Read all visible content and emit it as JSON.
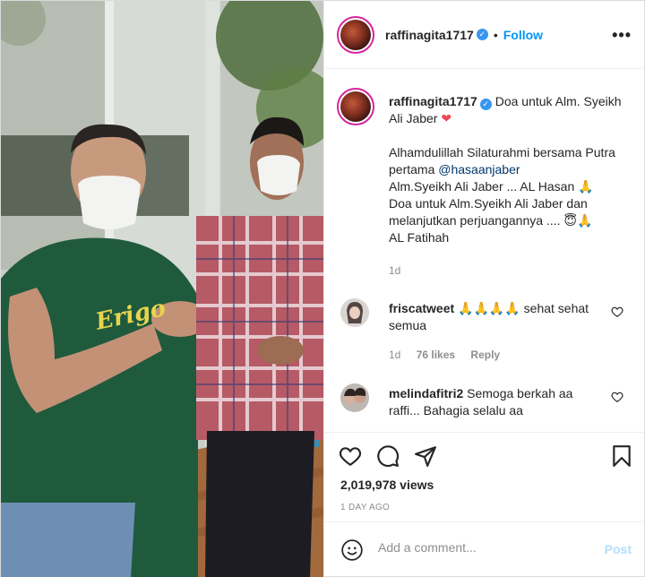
{
  "header": {
    "username": "raffinagita1717",
    "follow_label": "Follow",
    "more_label": "•••"
  },
  "caption": {
    "username": "raffinagita1717",
    "text_1": "Doa untuk Alm. Syeikh Ali Jaber",
    "line_1": "Alhamdulillah Silaturahmi bersama Putra pertama",
    "mention": "@hasaanjaber",
    "line_2": "Alm.Syeikh Ali Jaber ... AL Hasan",
    "line_3": "Doa untuk Alm.Syeikh Ali Jaber dan melanjutkan perjuangannya ....",
    "line_4": "AL Fatihah",
    "time": "1d"
  },
  "comments": [
    {
      "username": "friscatweet",
      "text": "sehat sehat semua",
      "time": "1d",
      "likes": "76 likes",
      "reply": "Reply"
    },
    {
      "username": "melindafitri2",
      "text": "Semoga berkah aa raffi... Bahagia selalu aa"
    }
  ],
  "stats": {
    "views": "2,019,978 views",
    "time_ago": "1 DAY AGO"
  },
  "add_comment": {
    "placeholder": "Add a comment...",
    "post_label": "Post"
  },
  "media": {
    "shirt_text": "Erigo"
  },
  "colors": {
    "link": "#0095f6",
    "mention": "#00376b",
    "muted": "#8e8e8e",
    "verified": "#3897f0",
    "heart": "#ed4956",
    "post_disabled": "#b2dffc"
  }
}
